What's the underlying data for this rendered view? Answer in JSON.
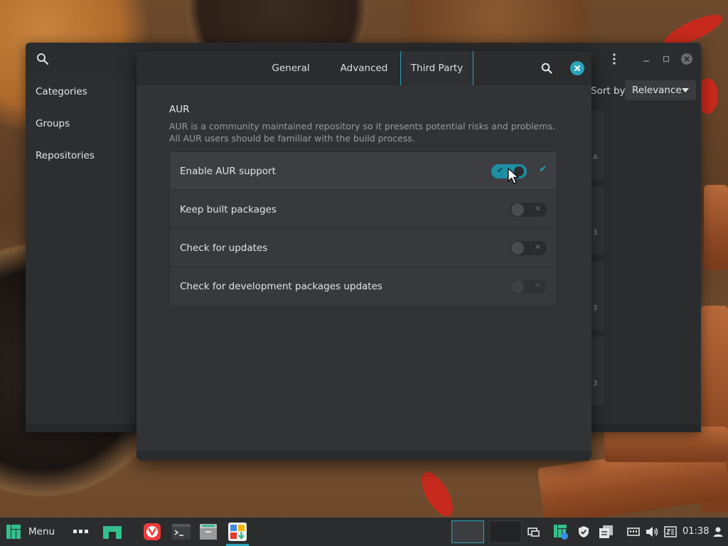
{
  "app": {
    "sidebar": {
      "items": [
        "Categories",
        "Groups",
        "Repositories"
      ]
    },
    "sort": {
      "label": "Sort by",
      "value": "Relevance"
    },
    "window_buttons": [
      "menu-kebab",
      "minimize",
      "maximize",
      "close"
    ],
    "list_fragments": [
      "A",
      "3",
      "3",
      "3"
    ]
  },
  "dialog": {
    "tabs": [
      {
        "label": "General",
        "active": false
      },
      {
        "label": "Advanced",
        "active": false
      },
      {
        "label": "Third Party",
        "active": true
      }
    ],
    "section": {
      "title": "AUR",
      "description": "AUR is a community maintained repository so it presents potential risks and problems. All AUR users should be familiar with the build process."
    },
    "options": [
      {
        "label": "Enable AUR support",
        "enabled": true,
        "sensitive": true
      },
      {
        "label": "Keep built packages",
        "enabled": false,
        "sensitive": true
      },
      {
        "label": "Check for updates",
        "enabled": false,
        "sensitive": true
      },
      {
        "label": "Check for development packages updates",
        "enabled": false,
        "sensitive": false
      }
    ]
  },
  "taskbar": {
    "menu_label": "Menu",
    "launchers": [
      "manjaro-logo-icon",
      "apps-grid-icon",
      "desktop-icon",
      "vivaldi-icon",
      "terminal-icon",
      "file-manager-icon",
      "software-store-icon"
    ],
    "workspaces": 2,
    "active_workspace": 1,
    "tray": [
      "window-switcher-icon",
      "pamac-updates-icon",
      "shield-icon",
      "clipboard-icon",
      "network-icon",
      "volume-icon",
      "keyboard-icon"
    ],
    "clock": "01:38"
  },
  "colors": {
    "accent": "#2aa3b8",
    "window_bg": "#2b2c2e",
    "dialog_bg": "#323335"
  }
}
